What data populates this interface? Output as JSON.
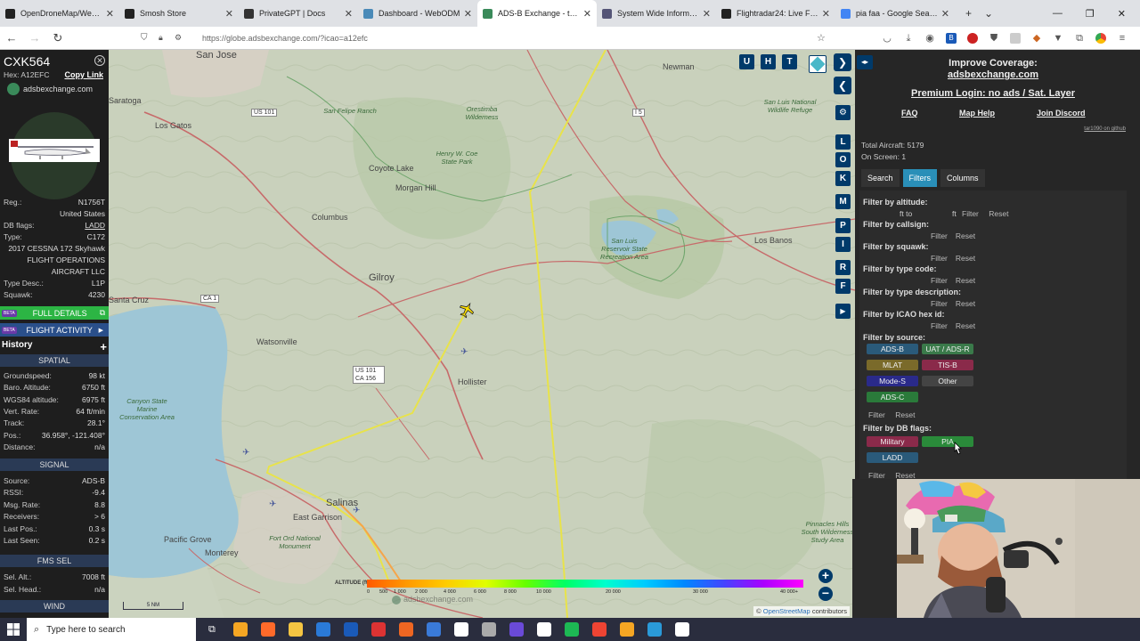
{
  "browser": {
    "tabs": [
      {
        "title": "OpenDroneMap/WebODM",
        "color": "#222"
      },
      {
        "title": "Smosh Store",
        "color": "#222"
      },
      {
        "title": "PrivateGPT | Docs",
        "color": "#333"
      },
      {
        "title": "Dashboard - WebODM",
        "color": "#4a8ab8"
      },
      {
        "title": "ADS-B Exchange - track air",
        "color": "#3a8a5a"
      },
      {
        "title": "System Wide Information M",
        "color": "#557"
      },
      {
        "title": "Flightradar24: Live Flight Tr",
        "color": "#222"
      },
      {
        "title": "pia faa - Google Search",
        "color": "#4285f4"
      }
    ],
    "url": "https://globe.adsbexchange.com/?icao=a12efc"
  },
  "aircraft": {
    "callsign": "CXK564",
    "hex_label": "Hex: A12EFC",
    "copy_link": "Copy Link",
    "source_site": "adsbexchange.com",
    "details": [
      {
        "k": "Reg.:",
        "v": "N1756T"
      },
      {
        "k": "",
        "v": "United States"
      },
      {
        "k": "DB flags:",
        "v": "LADD"
      },
      {
        "k": "Type:",
        "v": "C172"
      },
      {
        "k": "",
        "v": "2017 CESSNA 172 Skyhawk"
      },
      {
        "k": "",
        "v": "FLIGHT OPERATIONS"
      },
      {
        "k": "",
        "v": "AIRCRAFT LLC"
      },
      {
        "k": "Type Desc.:",
        "v": "L1P"
      },
      {
        "k": "Squawk:",
        "v": "4230"
      }
    ],
    "full_details": "FULL DETAILS",
    "flight_activity": "FLIGHT ACTIVITY",
    "beta": "BETA",
    "history": "History",
    "spatial_header": "SPATIAL",
    "spatial": [
      {
        "k": "Groundspeed:",
        "v": "98 kt"
      },
      {
        "k": "Baro. Altitude:",
        "v": "6750 ft"
      },
      {
        "k": "WGS84 altitude:",
        "v": "6975 ft"
      },
      {
        "k": "Vert. Rate:",
        "v": "64 ft/min"
      },
      {
        "k": "Track:",
        "v": "28.1°"
      },
      {
        "k": "Pos.:",
        "v": "36.958°, -121.408°"
      },
      {
        "k": "Distance:",
        "v": "n/a"
      }
    ],
    "signal_header": "SIGNAL",
    "signal": [
      {
        "k": "Source:",
        "v": "ADS-B"
      },
      {
        "k": "RSSI:",
        "v": "-9.4"
      },
      {
        "k": "Msg. Rate:",
        "v": "8.8"
      },
      {
        "k": "Receivers:",
        "v": "> 6"
      },
      {
        "k": "Last Pos.:",
        "v": "0.3 s"
      },
      {
        "k": "Last Seen:",
        "v": "0.2 s"
      }
    ],
    "fms_header": "FMS SEL",
    "fms": [
      {
        "k": "Sel. Alt.:",
        "v": "7008 ft"
      },
      {
        "k": "Sel. Head.:",
        "v": "n/a"
      }
    ],
    "wind_header": "WIND"
  },
  "map": {
    "places": [
      {
        "name": "San Jose",
        "cls": ""
      },
      {
        "name": "Newman",
        "cls": ""
      },
      {
        "name": "Los Gatos",
        "cls": ""
      },
      {
        "name": "Saratoga",
        "cls": ""
      },
      {
        "name": "Morgan Hill",
        "cls": ""
      },
      {
        "name": "Coyote Lake",
        "cls": ""
      },
      {
        "name": "Columbus",
        "cls": ""
      },
      {
        "name": "Gilroy",
        "cls": ""
      },
      {
        "name": "Los Banos",
        "cls": ""
      },
      {
        "name": "Hollister",
        "cls": ""
      },
      {
        "name": "Watsonville",
        "cls": ""
      },
      {
        "name": "Santa Cruz",
        "cls": ""
      },
      {
        "name": "Salinas",
        "cls": ""
      },
      {
        "name": "East Garrison",
        "cls": ""
      },
      {
        "name": "Pacific Grove",
        "cls": ""
      },
      {
        "name": "Monterey",
        "cls": ""
      },
      {
        "name": "Henry W. Coe State Park",
        "cls": "park"
      },
      {
        "name": "Orestimba Wilderness",
        "cls": "park"
      },
      {
        "name": "San Felipe Ranch",
        "cls": "park"
      },
      {
        "name": "San Luis Reservoir State Recreation Area",
        "cls": "park"
      },
      {
        "name": "Fort Ord National Monument",
        "cls": "park"
      },
      {
        "name": "San Luis National Wildlife Refuge",
        "cls": "park"
      },
      {
        "name": "Pinnacles Hills South Wilderness Study Area",
        "cls": "park"
      },
      {
        "name": "Canyon State Marine Conservation Area",
        "cls": "park"
      }
    ],
    "highways": [
      "US 101",
      "I 5",
      "CA 1",
      "US 101 CA 156"
    ],
    "right_buttons": [
      "L",
      "O",
      "K",
      "M",
      "P",
      "I",
      "R",
      "F"
    ],
    "top_buttons": [
      "U",
      "H",
      "T"
    ],
    "altitude_label": "ALTITUDE (ft)",
    "altitude_ticks": [
      "0",
      "500",
      "1 000",
      "2 000",
      "4 000",
      "6 000",
      "8 000",
      "10 000",
      "20 000",
      "30 000",
      "40 000+"
    ],
    "scale_label": "5 NM",
    "watermark": "adsbexchange.com",
    "attribution_prefix": "©",
    "attribution_link": "OpenStreetMap",
    "attribution_suffix": "contributors"
  },
  "rightpanel": {
    "improve_coverage": "Improve Coverage:",
    "site": "adsbexchange.com",
    "premium": "Premium Login: no ads / Sat. Layer",
    "links": [
      "FAQ",
      "Map Help",
      "Join Discord"
    ],
    "github": "tar1090 on github",
    "total_aircraft": "Total Aircraft: 5179",
    "on_screen": "On Screen: 1",
    "tabs": [
      "Search",
      "Filters",
      "Columns"
    ],
    "active_tab": "Filters",
    "filters": {
      "altitude": "Filter by altitude:",
      "altitude_units": [
        "ft to",
        "ft"
      ],
      "callsign": "Filter by callsign:",
      "squawk": "Filter by squawk:",
      "type_code": "Filter by type code:",
      "type_desc": "Filter by type description:",
      "icao": "Filter by ICAO hex id:",
      "source": "Filter by source:",
      "db_flags": "Filter by DB flags:",
      "filter_btn": "Filter",
      "reset_btn": "Reset"
    },
    "sources": [
      {
        "label": "ADS-B",
        "color": "#2a5a7a"
      },
      {
        "label": "UAT / ADS-R",
        "color": "#3a7a4a"
      },
      {
        "label": "MLAT",
        "color": "#7a6a2a"
      },
      {
        "label": "TIS-B",
        "color": "#8a2a4a"
      },
      {
        "label": "Mode-S",
        "color": "#2a2a8a"
      },
      {
        "label": "Other",
        "color": "#444444"
      },
      {
        "label": "ADS-C",
        "color": "#2a7a3a"
      }
    ],
    "db_flags": [
      {
        "label": "Military",
        "color": "#8a2a4a"
      },
      {
        "label": "PIA",
        "color": "#2a8a3a"
      },
      {
        "label": "LADD",
        "color": "#2a5a7a"
      }
    ]
  },
  "taskbar": {
    "search_placeholder": "Type here to search",
    "apps": [
      "#f5a623",
      "#ff6a2a",
      "#f5c542",
      "#2a7ad8",
      "#1a5ab8",
      "#dd3333",
      "#ee6622",
      "#3a7ad8",
      "#ffffff",
      "#aaaaaa",
      "#6a4ad8",
      "#ffffff",
      "#1db954",
      "#ee4433",
      "#f5a623",
      "#2a9ad8",
      "#ffffff"
    ]
  }
}
